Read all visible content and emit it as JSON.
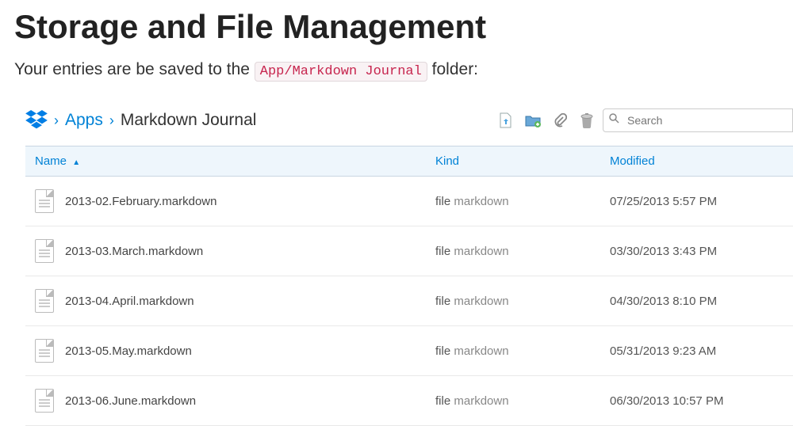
{
  "heading": "Storage and File Management",
  "intro_pre": "Your entries are be saved to the ",
  "intro_path": "App/Markdown Journal",
  "intro_post": " folder:",
  "breadcrumb": {
    "link": "Apps",
    "current": "Markdown Journal"
  },
  "search": {
    "placeholder": "Search"
  },
  "columns": {
    "name": "Name",
    "kind": "Kind",
    "modified": "Modified"
  },
  "files": [
    {
      "name": "2013-02.February.markdown",
      "kind1": "file",
      "kind2": "markdown",
      "modified": "07/25/2013 5:57 PM"
    },
    {
      "name": "2013-03.March.markdown",
      "kind1": "file",
      "kind2": "markdown",
      "modified": "03/30/2013 3:43 PM"
    },
    {
      "name": "2013-04.April.markdown",
      "kind1": "file",
      "kind2": "markdown",
      "modified": "04/30/2013 8:10 PM"
    },
    {
      "name": "2013-05.May.markdown",
      "kind1": "file",
      "kind2": "markdown",
      "modified": "05/31/2013 9:23 AM"
    },
    {
      "name": "2013-06.June.markdown",
      "kind1": "file",
      "kind2": "markdown",
      "modified": "06/30/2013 10:57 PM"
    }
  ]
}
